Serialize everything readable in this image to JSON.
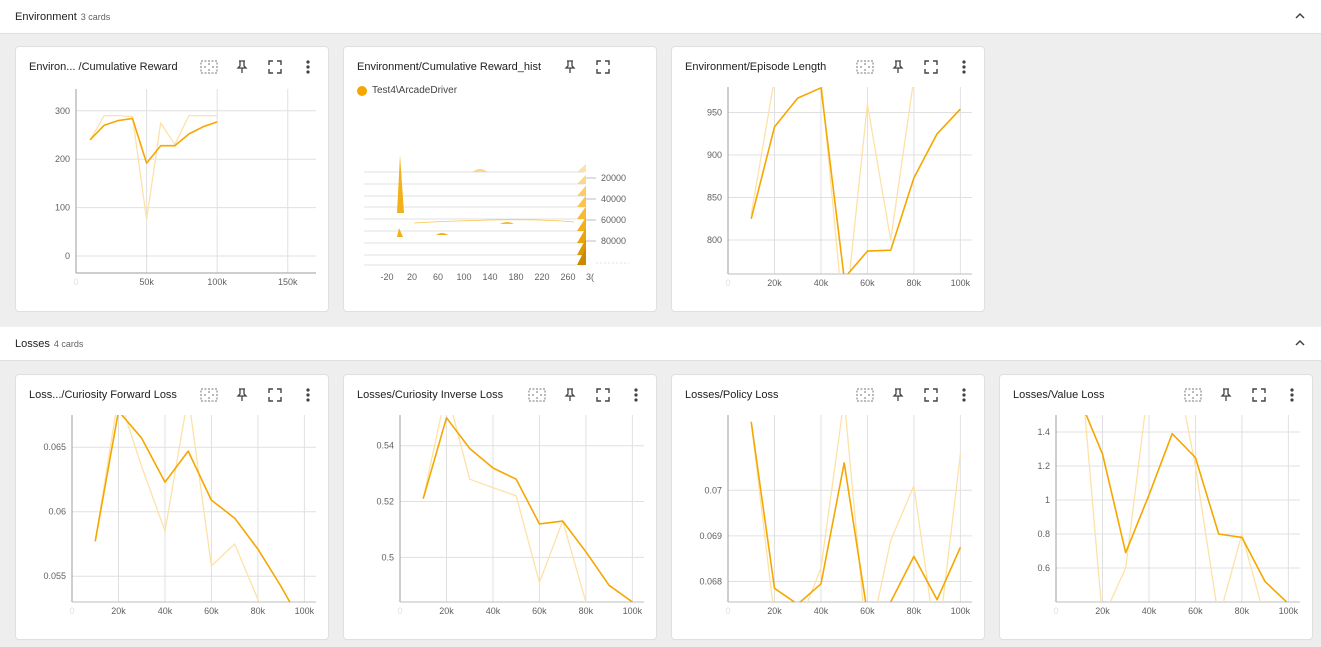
{
  "colors": {
    "accent": "#f5a700",
    "smoothed": "#f5a700",
    "raw": "#fde2a8",
    "grid": "#e0e0e0",
    "text": "#616161"
  },
  "groups": [
    {
      "title": "Environment",
      "count": "3 cards"
    },
    {
      "title": "Losses",
      "count": "4 cards"
    }
  ],
  "cards": [
    {
      "title": "Environ...  /Cumulative Reward"
    },
    {
      "title": "Environment/Cumulative Reward_hist",
      "legend": "Test4\\ArcadeDriver"
    },
    {
      "title": "Environment/Episode Length"
    },
    {
      "title": "Loss.../Curiosity Forward Loss"
    },
    {
      "title": "Losses/Curiosity Inverse Loss"
    },
    {
      "title": "Losses/Policy Loss"
    },
    {
      "title": "Losses/Value Loss"
    }
  ],
  "chart_data": [
    {
      "type": "line",
      "title": "Environ...  /Cumulative Reward",
      "xlim": [
        0,
        170000
      ],
      "ylim": [
        -35,
        345
      ],
      "x_ticks": [
        {
          "v": 0,
          "l": "0"
        },
        {
          "v": 50000,
          "l": "50k"
        },
        {
          "v": 100000,
          "l": "100k"
        },
        {
          "v": 150000,
          "l": "150k"
        }
      ],
      "y_ticks": [
        {
          "v": 0,
          "l": "0"
        },
        {
          "v": 100,
          "l": "100"
        },
        {
          "v": 200,
          "l": "200"
        },
        {
          "v": 300,
          "l": "300"
        }
      ],
      "series": [
        {
          "style": "raw",
          "x": [
            10000,
            20000,
            30000,
            40000,
            50000,
            60000,
            70000,
            80000,
            90000,
            100000
          ],
          "y": [
            240,
            290,
            290,
            288,
            75,
            275,
            230,
            290,
            290,
            290
          ]
        },
        {
          "style": "smoothed",
          "x": [
            10000,
            20000,
            30000,
            40000,
            50000,
            60000,
            70000,
            80000,
            90000,
            100000
          ],
          "y": [
            240,
            270,
            280,
            284,
            192,
            228,
            228,
            252,
            267,
            277
          ]
        }
      ]
    },
    {
      "type": "histogram",
      "title": "Environment/Cumulative Reward_hist",
      "x_ticks": [
        "-20",
        "20",
        "60",
        "100",
        "140",
        "180",
        "220",
        "260",
        "3("
      ],
      "step_ticks": [
        "20000",
        "40000",
        "60000",
        "80000"
      ]
    },
    {
      "type": "line",
      "title": "Environment/Episode Length",
      "xlim": [
        0,
        105000
      ],
      "ylim": [
        760,
        980
      ],
      "x_ticks": [
        {
          "v": 0,
          "l": "0"
        },
        {
          "v": 20000,
          "l": "20k"
        },
        {
          "v": 40000,
          "l": "40k"
        },
        {
          "v": 60000,
          "l": "60k"
        },
        {
          "v": 80000,
          "l": "80k"
        },
        {
          "v": 100000,
          "l": "100k"
        }
      ],
      "y_ticks": [
        {
          "v": 800,
          "l": "800"
        },
        {
          "v": 850,
          "l": "850"
        },
        {
          "v": 900,
          "l": "900"
        },
        {
          "v": 950,
          "l": "950"
        }
      ],
      "series": [
        {
          "style": "raw",
          "x": [
            10000,
            20000,
            30000,
            40000,
            50000,
            60000,
            70000,
            80000,
            90000,
            100000
          ],
          "y": [
            830,
            990,
            990,
            990,
            700,
            960,
            800,
            990,
            990,
            990
          ]
        },
        {
          "style": "smoothed",
          "x": [
            10000,
            20000,
            30000,
            40000,
            50000,
            60000,
            70000,
            80000,
            90000,
            100000
          ],
          "y": [
            825,
            933,
            967,
            979,
            755,
            787,
            788,
            873,
            925,
            954
          ]
        }
      ]
    },
    {
      "type": "line",
      "title": "Loss.../Curiosity Forward Loss",
      "xlim": [
        0,
        105000
      ],
      "ylim": [
        0.053,
        0.0675
      ],
      "x_ticks": [
        {
          "v": 0,
          "l": "0"
        },
        {
          "v": 20000,
          "l": "20k"
        },
        {
          "v": 40000,
          "l": "40k"
        },
        {
          "v": 60000,
          "l": "60k"
        },
        {
          "v": 80000,
          "l": "80k"
        },
        {
          "v": 100000,
          "l": "100k"
        }
      ],
      "y_ticks": [
        {
          "v": 0.055,
          "l": "0.055"
        },
        {
          "v": 0.06,
          "l": "0.06"
        },
        {
          "v": 0.065,
          "l": "0.065"
        }
      ],
      "series": [
        {
          "style": "raw",
          "x": [
            10000,
            20000,
            30000,
            40000,
            50000,
            60000,
            70000,
            80000,
            90000,
            100000
          ],
          "y": [
            0.0577,
            0.069,
            0.0635,
            0.0585,
            0.069,
            0.0558,
            0.0575,
            0.0532,
            0.05,
            0.05
          ]
        },
        {
          "style": "smoothed",
          "x": [
            10000,
            20000,
            30000,
            40000,
            50000,
            60000,
            70000,
            80000,
            90000,
            100000
          ],
          "y": [
            0.0577,
            0.0678,
            0.0657,
            0.0623,
            0.0647,
            0.0609,
            0.0595,
            0.0571,
            0.0542,
            0.051
          ]
        }
      ]
    },
    {
      "type": "line",
      "title": "Losses/Curiosity Inverse Loss",
      "xlim": [
        0,
        105000
      ],
      "ylim": [
        0.484,
        0.551
      ],
      "x_ticks": [
        {
          "v": 0,
          "l": "0"
        },
        {
          "v": 20000,
          "l": "20k"
        },
        {
          "v": 40000,
          "l": "40k"
        },
        {
          "v": 60000,
          "l": "60k"
        },
        {
          "v": 80000,
          "l": "80k"
        },
        {
          "v": 100000,
          "l": "100k"
        }
      ],
      "y_ticks": [
        {
          "v": 0.5,
          "l": "0.5"
        },
        {
          "v": 0.52,
          "l": "0.52"
        },
        {
          "v": 0.54,
          "l": "0.54"
        }
      ],
      "series": [
        {
          "style": "raw",
          "x": [
            10000,
            20000,
            30000,
            40000,
            50000,
            60000,
            70000,
            80000,
            90000,
            100000
          ],
          "y": [
            0.521,
            0.56,
            0.528,
            0.525,
            0.522,
            0.491,
            0.513,
            0.484,
            0.48,
            0.48
          ]
        },
        {
          "style": "smoothed",
          "x": [
            10000,
            20000,
            30000,
            40000,
            50000,
            60000,
            70000,
            80000,
            90000,
            100000
          ],
          "y": [
            0.521,
            0.55,
            0.539,
            0.532,
            0.528,
            0.512,
            0.513,
            0.502,
            0.49,
            0.484
          ]
        }
      ]
    },
    {
      "type": "line",
      "title": "Losses/Policy Loss",
      "xlim": [
        0,
        105000
      ],
      "ylim": [
        0.06755,
        0.07165
      ],
      "x_ticks": [
        {
          "v": 0,
          "l": "0"
        },
        {
          "v": 20000,
          "l": "20k"
        },
        {
          "v": 40000,
          "l": "40k"
        },
        {
          "v": 60000,
          "l": "60k"
        },
        {
          "v": 80000,
          "l": "80k"
        },
        {
          "v": 100000,
          "l": "100k"
        }
      ],
      "y_ticks": [
        {
          "v": 0.068,
          "l": "0.068"
        },
        {
          "v": 0.069,
          "l": "0.069"
        },
        {
          "v": 0.07,
          "l": "0.07"
        }
      ],
      "series": [
        {
          "style": "raw",
          "x": [
            10000,
            20000,
            30000,
            40000,
            50000,
            60000,
            70000,
            80000,
            90000,
            100000
          ],
          "y": [
            0.0715,
            0.0672,
            0.067,
            0.0683,
            0.072,
            0.0665,
            0.0689,
            0.0701,
            0.0665,
            0.0708
          ]
        },
        {
          "style": "smoothed",
          "x": [
            10000,
            20000,
            30000,
            40000,
            50000,
            60000,
            70000,
            80000,
            90000,
            100000
          ],
          "y": [
            0.0715,
            0.06785,
            0.0675,
            0.06795,
            0.0706,
            0.0673,
            0.06755,
            0.06855,
            0.0676,
            0.06875
          ]
        }
      ]
    },
    {
      "type": "line",
      "title": "Losses/Value Loss",
      "xlim": [
        0,
        105000
      ],
      "ylim": [
        0.4,
        1.5
      ],
      "x_ticks": [
        {
          "v": 0,
          "l": "0"
        },
        {
          "v": 20000,
          "l": "20k"
        },
        {
          "v": 40000,
          "l": "40k"
        },
        {
          "v": 60000,
          "l": "60k"
        },
        {
          "v": 80000,
          "l": "80k"
        },
        {
          "v": 100000,
          "l": "100k"
        }
      ],
      "y_ticks": [
        {
          "v": 0.6,
          "l": "0.6"
        },
        {
          "v": 0.8,
          "l": "0.8"
        },
        {
          "v": 1,
          "l": "1"
        },
        {
          "v": 1.2,
          "l": "1.2"
        },
        {
          "v": 1.4,
          "l": "1.4"
        }
      ],
      "series": [
        {
          "style": "raw",
          "x": [
            10000,
            20000,
            30000,
            40000,
            50000,
            60000,
            70000,
            80000,
            90000,
            100000
          ],
          "y": [
            1.9,
            0.3,
            0.6,
            1.7,
            1.9,
            1.2,
            0.3,
            0.8,
            0.3,
            0.3
          ]
        },
        {
          "style": "smoothed",
          "x": [
            10000,
            20000,
            30000,
            40000,
            50000,
            60000,
            70000,
            80000,
            90000,
            100000
          ],
          "y": [
            1.6,
            1.27,
            0.69,
            1.03,
            1.39,
            1.25,
            0.8,
            0.78,
            0.52,
            0.39
          ]
        }
      ]
    }
  ]
}
